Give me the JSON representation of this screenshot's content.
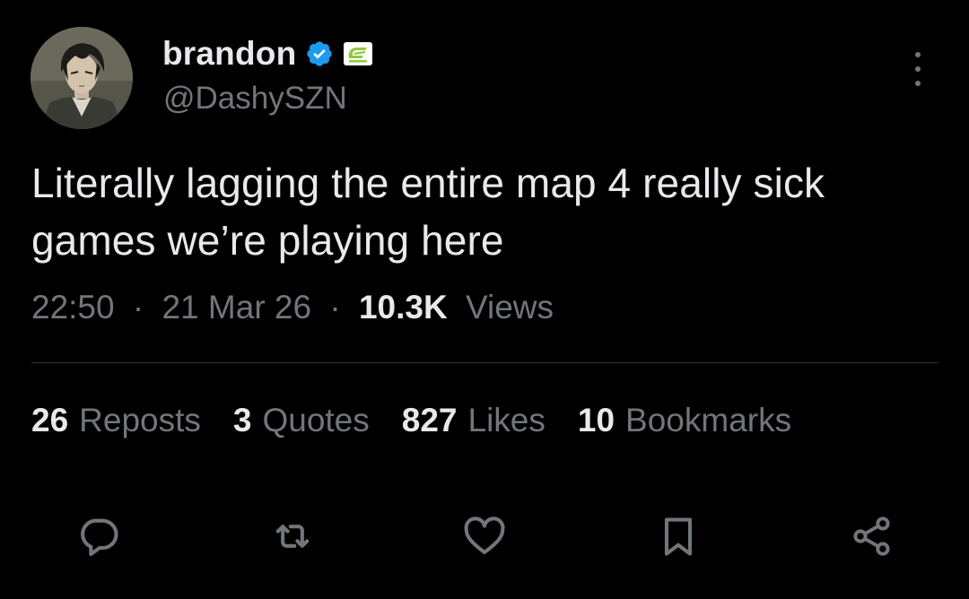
{
  "author": {
    "display_name": "brandon",
    "handle": "@DashySZN",
    "verified": true,
    "avatar_icon": "anime-character-avatar",
    "org_icon": "optic-gaming-logo-icon",
    "verified_color": "#1d9bf0",
    "org_color": "#93c83e"
  },
  "tweet": {
    "text": "Literally lagging the entire map 4 really sick games we’re playing here",
    "time": "22:50",
    "date": "21 Mar 26",
    "separator": "·",
    "views_count": "10.3K",
    "views_label": "Views"
  },
  "stats": {
    "reposts_count": "26",
    "reposts_label": "Reposts",
    "quotes_count": "3",
    "quotes_label": "Quotes",
    "likes_count": "827",
    "likes_label": "Likes",
    "bookmarks_count": "10",
    "bookmarks_label": "Bookmarks"
  },
  "actions": {
    "reply_icon": "reply-icon",
    "repost_icon": "repost-icon",
    "like_icon": "heart-icon",
    "bookmark_icon": "bookmark-icon",
    "share_icon": "share-icon"
  },
  "theme": {
    "background": "#000000",
    "text_primary": "#e7e9ea",
    "text_secondary": "#71767b",
    "divider": "#2f3336"
  }
}
